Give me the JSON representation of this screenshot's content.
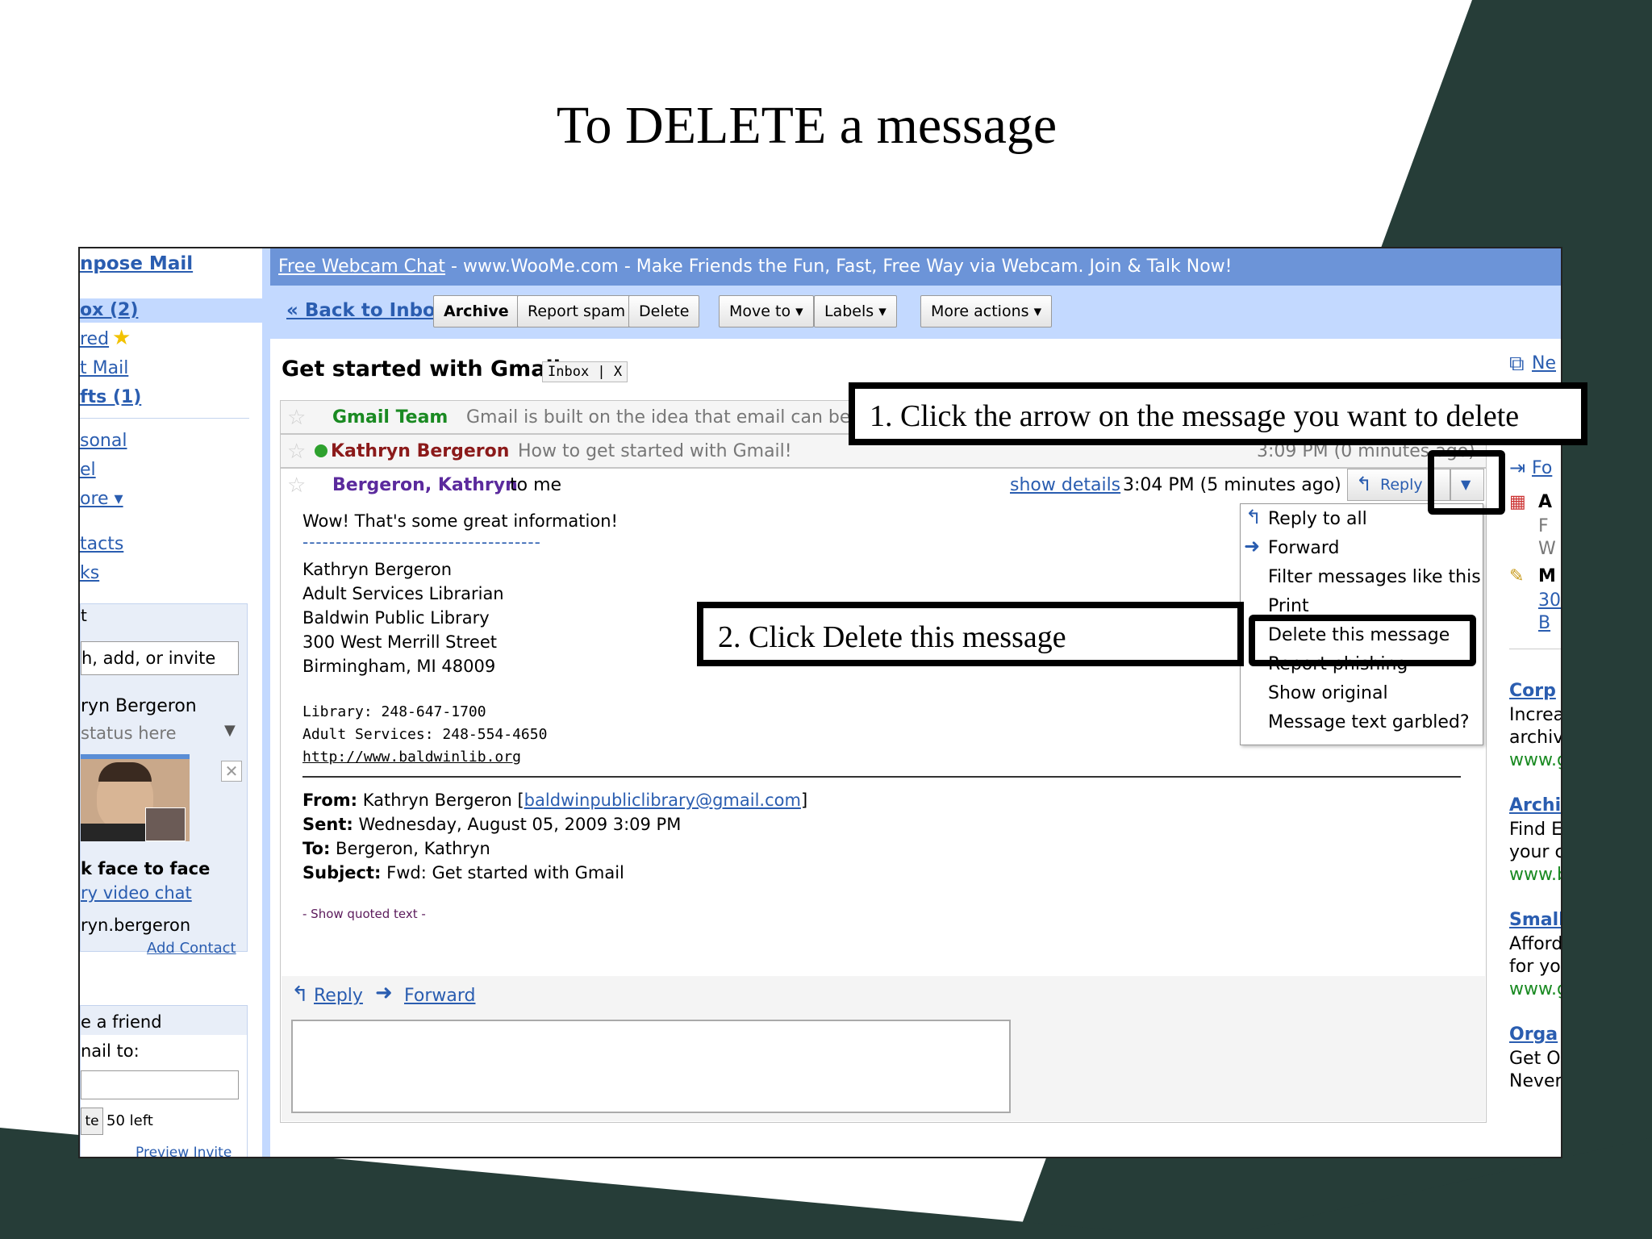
{
  "slide": {
    "title": "To DELETE a message"
  },
  "left_nav": {
    "compose": "npose Mail",
    "inbox": "ox (2)",
    "starred": "red",
    "sent": "t Mail",
    "drafts": "fts (1)",
    "personal": "sonal",
    "travel": "el",
    "more": "ore ▾",
    "contacts": "tacts",
    "tasks": "ks",
    "chat_header": "t",
    "search_placeholder": "h, add, or invite",
    "user_name": "ryn Bergeron",
    "status": "status here",
    "video_caption": "k face to face",
    "video_link": "ry video chat",
    "contact_user": "ryn.bergeron",
    "add_contact": "Add Contact",
    "invite_header": "e a friend",
    "invite_label": "nail to:",
    "invite_button": "te",
    "invites_left": "50 left",
    "preview_invite": "Preview Invite"
  },
  "ad": {
    "link": "Free Webcam Chat",
    "text": " - www.WooMe.com - Make Friends the Fun, Fast, Free Way via Webcam. Join & Talk Now!"
  },
  "toolbar": {
    "back": "« Back to Inbox",
    "archive": "Archive",
    "spam": "Report spam",
    "delete": "Delete",
    "move": "Move to ▾",
    "labels": "Labels ▾",
    "more": "More actions ▾"
  },
  "thread": {
    "subject": "Get started with Gmail",
    "label": "Inbox | X",
    "messages": [
      {
        "sender": "Gmail Team",
        "snippet": "Gmail is built on the idea that email can be in"
      },
      {
        "sender": "Kathryn Bergeron",
        "snippet": "How to get started with Gmail!",
        "time": "3:09 PM (0 minutes ago)"
      }
    ],
    "open": {
      "sender": "Bergeron, Kathryn",
      "to": "to me",
      "show_details": "show details",
      "time": "3:04 PM (5 minutes ago)",
      "reply": "Reply",
      "arrow": "▼",
      "body": {
        "line1": "Wow! That's some great information!",
        "dashes": "------------------------------------",
        "sig": [
          "Kathryn Bergeron",
          "Adult Services Librarian",
          "Baldwin Public Library",
          "300 West Merrill Street",
          "Birmingham, MI 48009"
        ],
        "phone1": "Library: 248-647-1700",
        "phone2": "Adult Services: 248-554-4650",
        "url": "http://www.baldwinlib.org",
        "from_label": "From:",
        "from_name": " Kathryn Bergeron [",
        "from_email": "baldwinpubliclibrary@gmail.com",
        "from_close": "]",
        "sent_label": "Sent:",
        "sent_value": " Wednesday, August 05, 2009 3:09 PM",
        "to_label": "To:",
        "to_value": " Bergeron, Kathryn",
        "subject_label": "Subject:",
        "subject_value": " Fwd: Get started with Gmail",
        "quoted": "- Show quoted text -"
      }
    },
    "footer": {
      "reply": "Reply",
      "forward": "Forward"
    }
  },
  "menu": {
    "items": [
      "Reply to all",
      "Forward",
      "Filter messages like this",
      "Print",
      "Delete this message",
      "Report phishing",
      "Show original",
      "Message text garbled?"
    ]
  },
  "callouts": {
    "step1": "1. Click the arrow on the message you want to delete",
    "step2": "2. Click Delete this message"
  },
  "right_col": {
    "new_window": "Ne",
    "forward_all": "Fo",
    "a": "A",
    "f": "F",
    "w": "W",
    "m": "M",
    "n30": "30",
    "b": "B",
    "ads": [
      {
        "title": "Corp",
        "l1": "Increa",
        "l2": "archivi",
        "url": "www.g"
      },
      {
        "title": "Archi",
        "l1": "Find E",
        "l2": "your c",
        "url": "www.b"
      },
      {
        "title": "Small",
        "l1": "Afford",
        "l2": "for you",
        "url": "www.g"
      },
      {
        "title": "Orga",
        "l1": "Get O",
        "l2": "Never"
      }
    ]
  },
  "colors": {
    "slide_dark": "#263d38",
    "gmail_blue": "#c3d9ff",
    "ad_bar": "#6c94d8",
    "link": "#2a5db0"
  }
}
